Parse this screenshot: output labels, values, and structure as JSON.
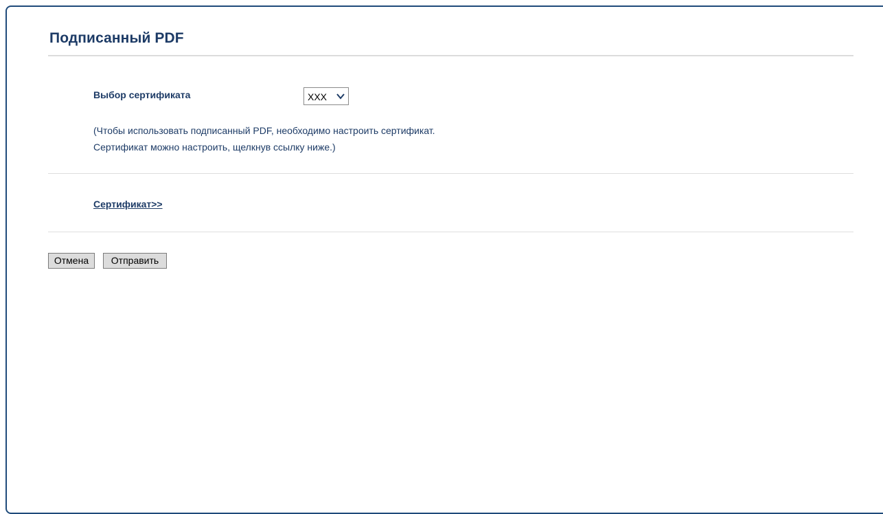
{
  "page": {
    "title": "Подписанный PDF"
  },
  "form": {
    "certificate_label": "Выбор сертификата",
    "certificate_select": {
      "selected": "XXX",
      "icon": "chevron-down-icon"
    },
    "note_lines": [
      "(Чтобы использовать подписанный PDF, необходимо настроить сертификат.",
      "Сертификат можно настроить, щелкнув ссылку ниже.)"
    ],
    "certificate_link": "Сертификат>>"
  },
  "buttons": {
    "cancel_label": "Отмена",
    "submit_label": "Отправить"
  },
  "colors": {
    "heading": "#1d3b66",
    "frame_border": "#1e4a7a",
    "button_bg": "#dcdcdc"
  }
}
